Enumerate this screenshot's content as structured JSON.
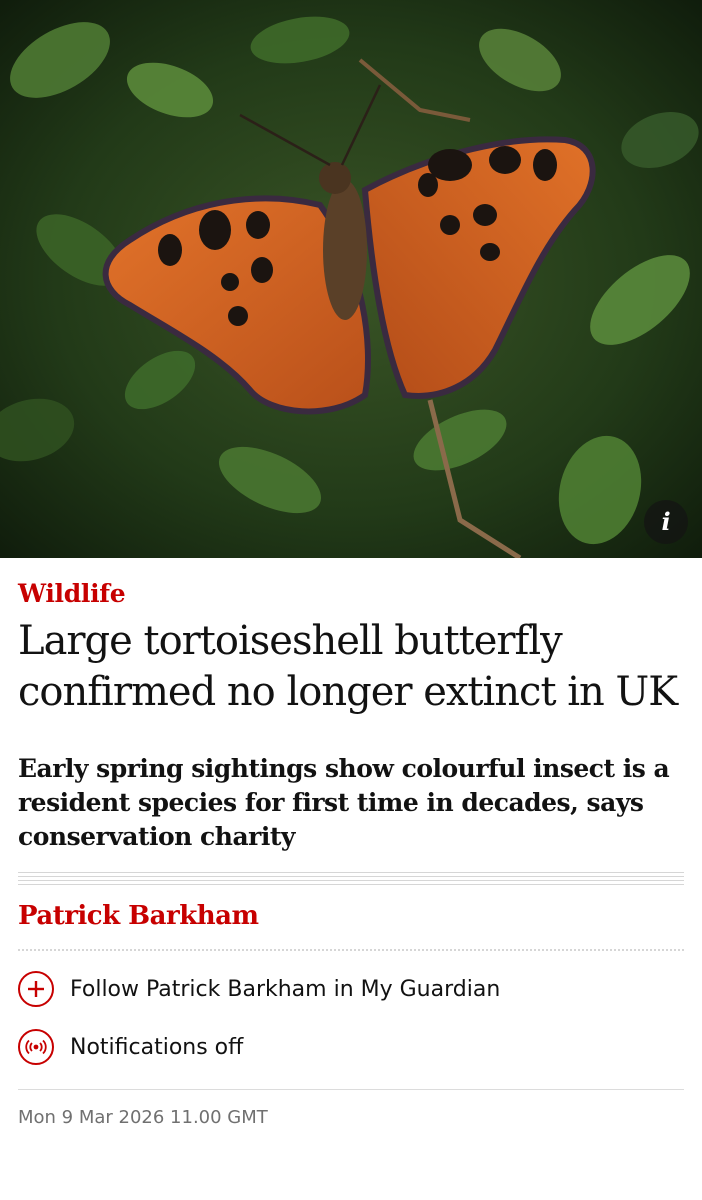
{
  "hero": {
    "info_icon": "info-icon",
    "info_label": "i",
    "colors": {
      "wing_orange": "#d8661e",
      "leaf_dark": "#1f3418"
    }
  },
  "article": {
    "kicker": "Wildlife",
    "headline": "Large tortoiseshell butterfly confirmed no longer extinct in UK",
    "standfirst": "Early spring sightings show colourful insect is a resident species for first time in decades, says conservation charity",
    "byline": "Patrick Barkham",
    "follow_label": "Follow Patrick Barkham in My Guardian",
    "follow_icon": "plus-icon",
    "notifications_label": "Notifications off",
    "notifications_icon": "broadcast-icon",
    "dateline": "Mon 9 Mar 2026 11.00 GMT",
    "accent_color": "#c70000"
  }
}
